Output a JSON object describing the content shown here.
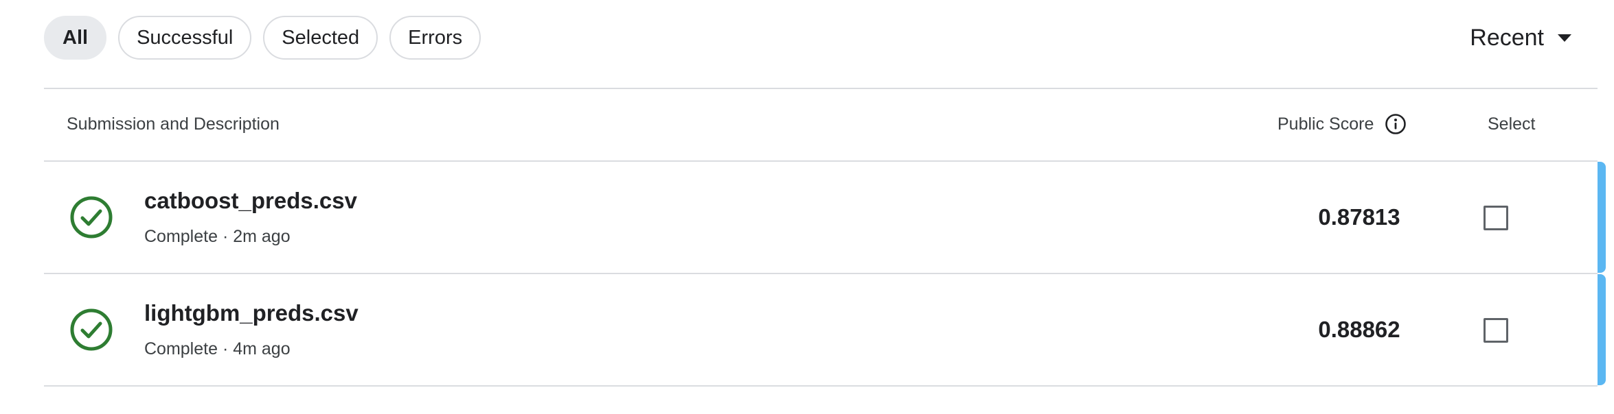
{
  "filters": {
    "all": "All",
    "successful": "Successful",
    "selected": "Selected",
    "errors": "Errors"
  },
  "sort": {
    "label": "Recent",
    "icon": "caret-down-icon"
  },
  "table": {
    "header": {
      "description": "Submission and Description",
      "score": "Public Score",
      "score_icon": "info-icon",
      "select": "Select"
    },
    "rows": [
      {
        "file": "catboost_preds.csv",
        "status": "Complete",
        "separator": "·",
        "time": "2m ago",
        "meta": "Complete · 2m ago",
        "score": "0.87813",
        "selected": false,
        "status_icon": "check-circle-icon"
      },
      {
        "file": "lightgbm_preds.csv",
        "status": "Complete",
        "separator": "·",
        "time": "4m ago",
        "meta": "Complete · 4m ago",
        "score": "0.88862",
        "selected": false,
        "status_icon": "check-circle-icon"
      }
    ]
  },
  "colors": {
    "success_green": "#2e7d32",
    "accent_blue": "#5bb7f2",
    "chip_active_bg": "#e8eaed",
    "divider": "#dadce0"
  }
}
